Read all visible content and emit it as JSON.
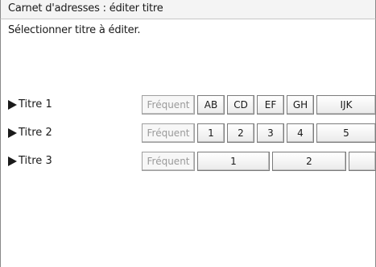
{
  "header": {
    "title": "Carnet d'adresses : éditer titre"
  },
  "main": {
    "instruction": "Sélectionner titre à éditer.",
    "rows": [
      {
        "label": "Titre 1",
        "buttons": [
          "Fréquent",
          "AB",
          "CD",
          "EF",
          "GH",
          "IJK"
        ]
      },
      {
        "label": "Titre 2",
        "buttons": [
          "Fréquent",
          "1",
          "2",
          "3",
          "4",
          "5"
        ]
      },
      {
        "label": "Titre 3",
        "buttons": [
          "Fréquent",
          "1",
          "2",
          ""
        ]
      }
    ]
  },
  "icons": {
    "row_marker": "triangle-right-icon"
  },
  "colors": {
    "disabled_text": "#9a9a9a",
    "frame_border": "#8a8a8a"
  }
}
